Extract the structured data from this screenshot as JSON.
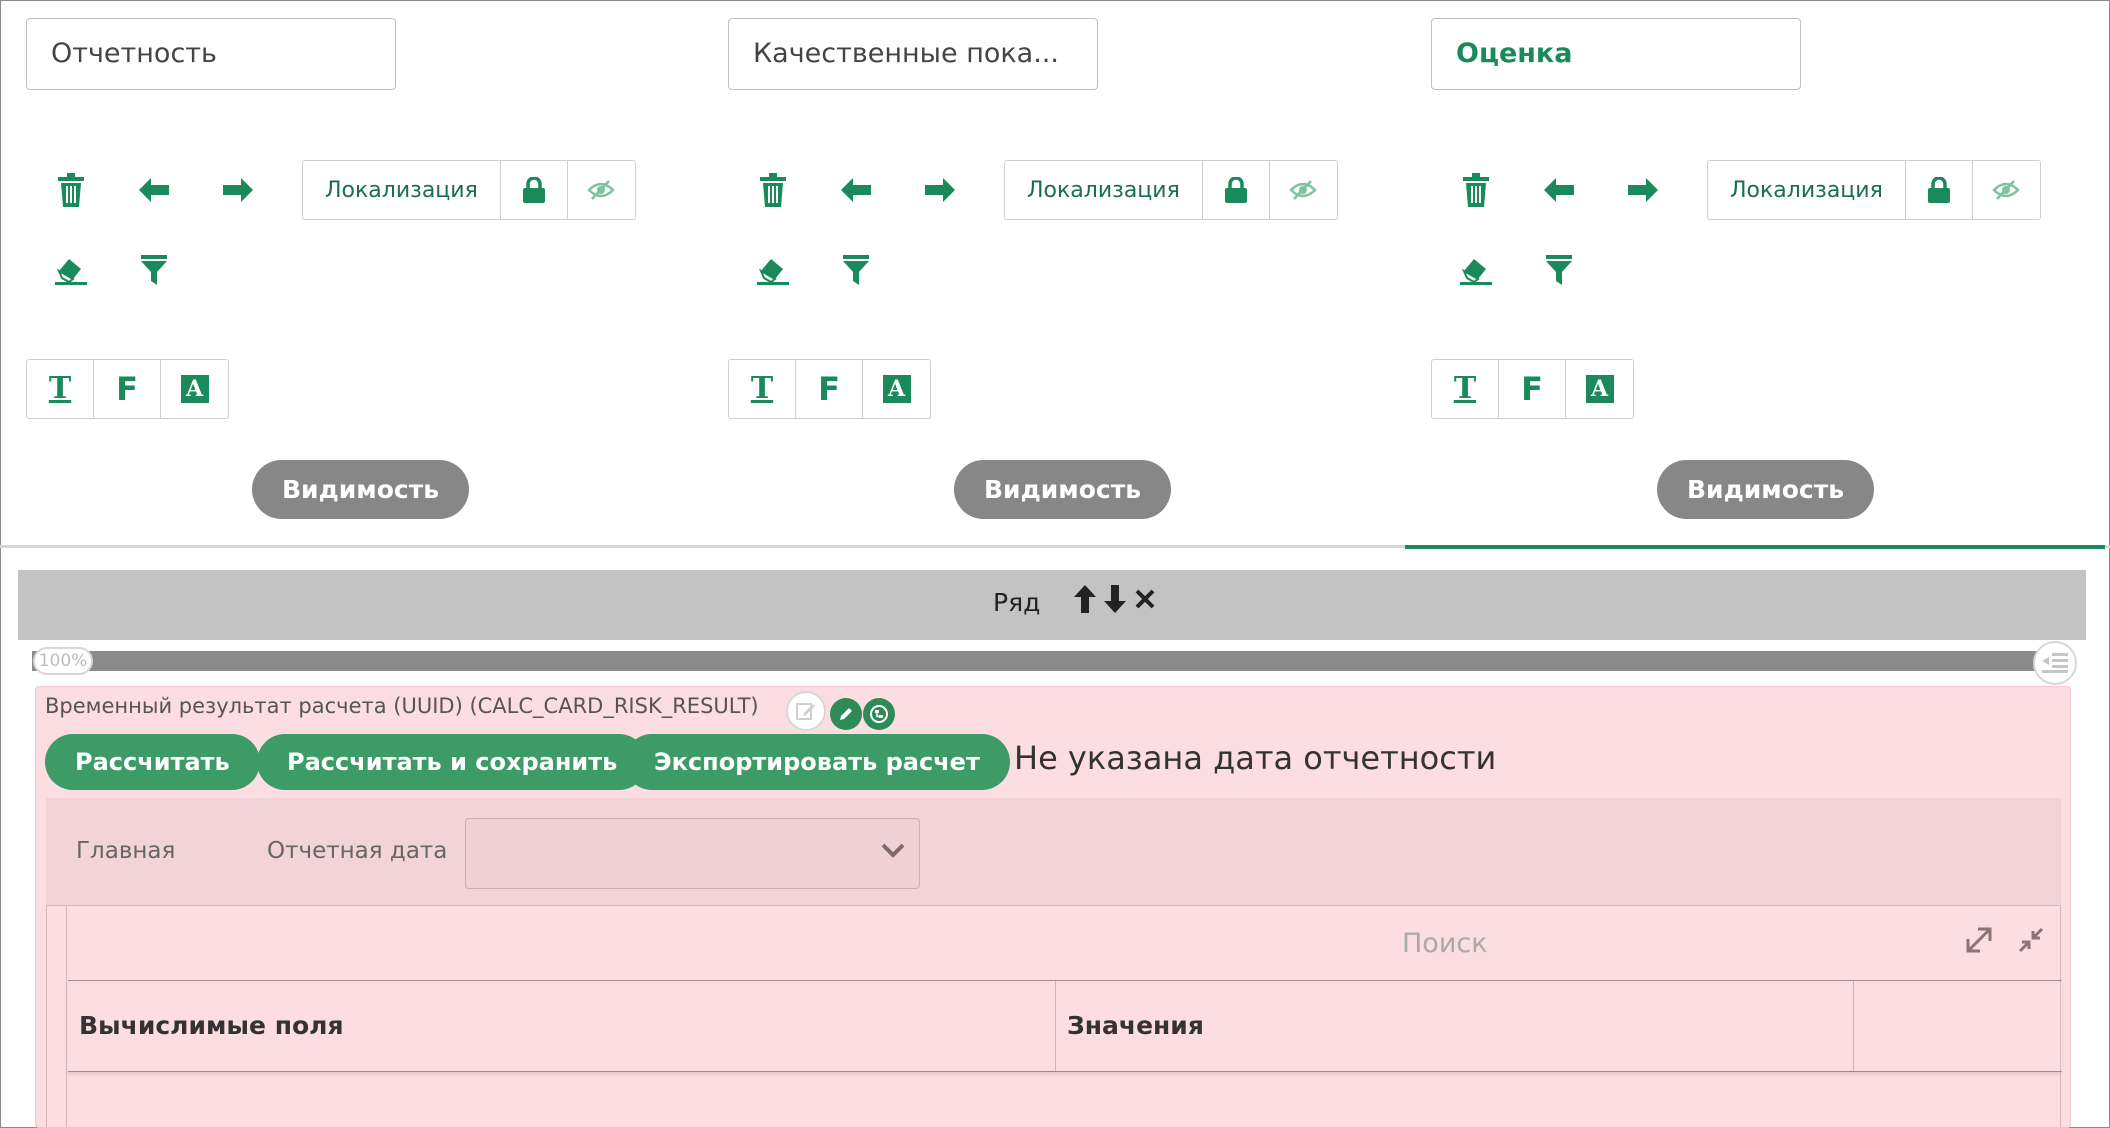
{
  "tabs": [
    {
      "name": "Отчетность",
      "active": false
    },
    {
      "name": "Качественные пока...",
      "active": false
    },
    {
      "name": "Оценка",
      "active": true
    }
  ],
  "tab_controls": {
    "localization_label": "Локализация",
    "format_text_glyph": "T",
    "format_formula_glyph": "F",
    "format_font_glyph": "A",
    "visibility_label": "Видимость"
  },
  "icons": {
    "trash": "trash-icon",
    "move_left": "arrow-left-icon",
    "move_right": "arrow-right-icon",
    "lock": "lock-icon",
    "hide": "eye-slash-icon",
    "eraser": "eraser-icon",
    "filter": "filter-icon"
  },
  "row": {
    "title": "Ряд",
    "width_percent": "100%"
  },
  "widget": {
    "caption": "Временный результат расчета (UUID) (CALC_CARD_RISK_RESULT)",
    "buttons": {
      "calculate": "Рассчитать",
      "calculate_save": "Рассчитать и сохранить",
      "export": "Экспортировать расчет"
    },
    "warning": "Не указана дата отчетности",
    "filter_tab": "Главная",
    "report_date_label": "Отчетная дата",
    "report_date_value": "",
    "search_placeholder": "Поиск",
    "columns": [
      "Вычислимые поля",
      "Значения",
      ""
    ]
  },
  "colors": {
    "accent_green": "#1a8a5a",
    "button_green": "#3d9b68",
    "pill_gray": "#878787",
    "widget_pink": "#fcdde1",
    "row_bar_gray": "#c3c3c3"
  }
}
